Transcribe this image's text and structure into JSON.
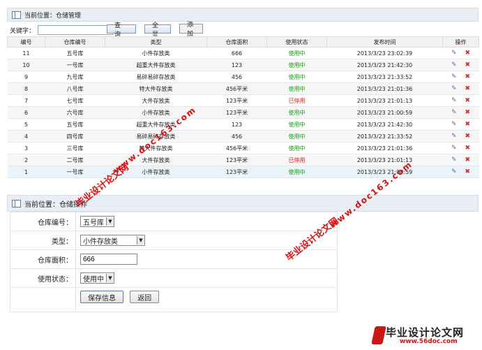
{
  "list_panel": {
    "title": "当前位置：仓储管理"
  },
  "search": {
    "label": "关键字：",
    "value": "",
    "query_label": "查 询",
    "all_label": "全 显",
    "add_label": "添 加"
  },
  "table": {
    "headers": [
      "编号",
      "仓库编号",
      "类型",
      "仓库面积",
      "使用状态",
      "发布时间",
      "操作"
    ],
    "rows": [
      [
        "11",
        "五号库",
        "小件存放类",
        "666",
        "使用中",
        "2013/3/23 23:02:39"
      ],
      [
        "10",
        "一号库",
        "超重大件存放类",
        "123",
        "使用中",
        "2013/3/23 21:42:30"
      ],
      [
        "9",
        "九号库",
        "易碎易碎存放类",
        "456",
        "使用中",
        "2013/3/23 21:33:52"
      ],
      [
        "8",
        "八号库",
        "特大件存放类",
        "456平米",
        "使用中",
        "2013/3/23 21:01:36"
      ],
      [
        "7",
        "七号库",
        "大件存放类",
        "123平米",
        "已停用",
        "2013/3/23 21:01:13"
      ],
      [
        "6",
        "六号库",
        "小件存放类",
        "123平米",
        "使用中",
        "2013/3/23 21:00:59"
      ],
      [
        "5",
        "五号库",
        "超重大件存放类",
        "123",
        "使用中",
        "2013/3/23 21:42:30"
      ],
      [
        "4",
        "四号库",
        "易碎易碎存放类",
        "456",
        "使用中",
        "2013/3/23 21:33:52"
      ],
      [
        "3",
        "三号库",
        "特大件存放类",
        "456平米",
        "使用中",
        "2013/3/23 21:01:36"
      ],
      [
        "2",
        "二号库",
        "大件存放类",
        "123平米",
        "已停用",
        "2013/3/23 21:01:13"
      ],
      [
        "1",
        "一号库",
        "小件存放类",
        "123平米",
        "使用中",
        "2013/3/23 21:00:59"
      ]
    ],
    "status_colors": {
      "使用中": "#18a018",
      "已停用": "#e02020"
    },
    "op_icons": [
      "edit-icon",
      "delete-icon"
    ]
  },
  "form_panel": {
    "title": "当前位置：仓储操作"
  },
  "form": {
    "warehouse_label": "仓库编号：",
    "warehouse_value": "五号库",
    "type_label": "类型：",
    "type_value": "小件存放类",
    "area_label": "仓库面积：",
    "area_value": "666",
    "status_label": "使用状态：",
    "status_value": "使用中",
    "save_label": "保存信息",
    "back_label": "返回"
  },
  "watermarks": {
    "cn": "毕业设计论文网",
    "url": "www.doc163.com"
  },
  "logo": {
    "title": "毕业设计论文网",
    "url": "www.56doc.com"
  }
}
